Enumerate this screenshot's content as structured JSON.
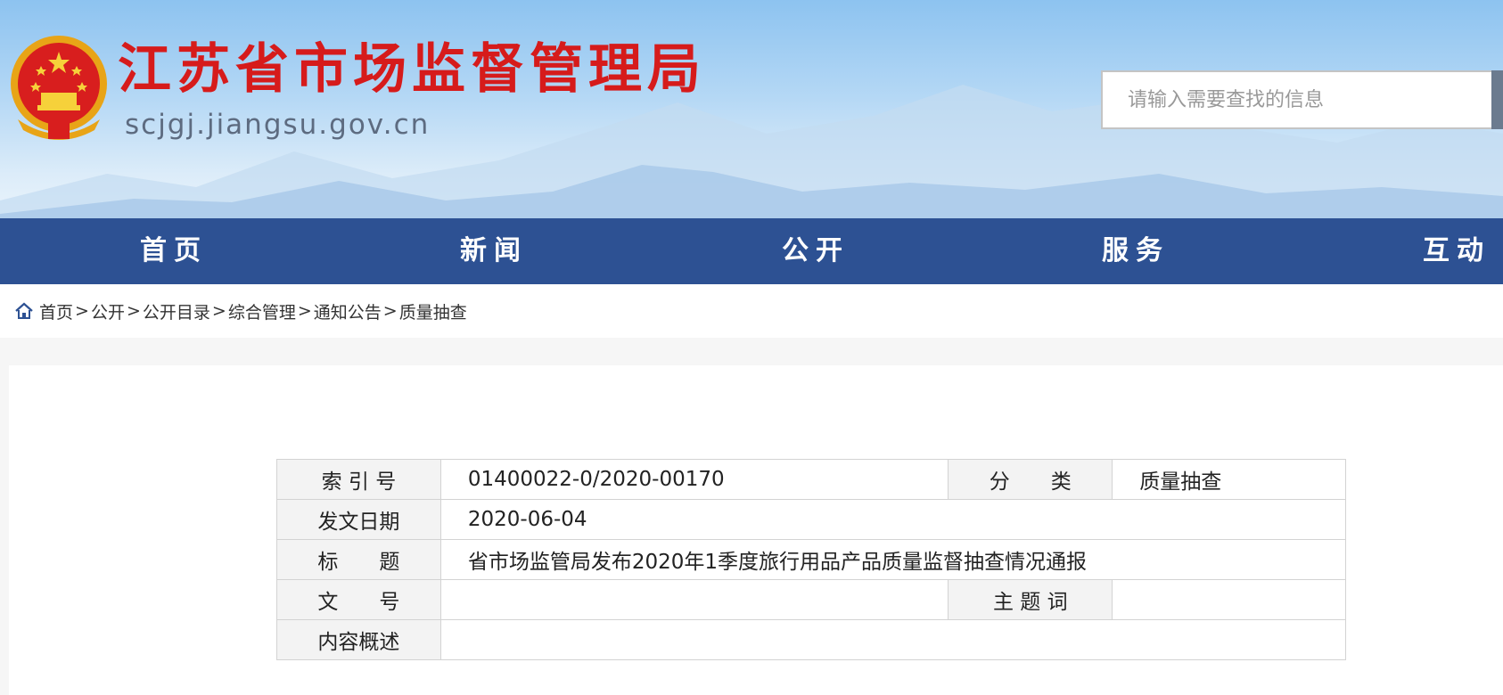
{
  "header": {
    "title": "江苏省市场监督管理局",
    "url": "scjgj.jiangsu.gov.cn",
    "emblem_icon": "national-emblem-icon",
    "brand_color": "#d61b1b",
    "search_placeholder": "请输入需要查找的信息"
  },
  "nav": {
    "color": "#2d5193",
    "items": [
      {
        "label": "首页"
      },
      {
        "label": "新闻"
      },
      {
        "label": "公开"
      },
      {
        "label": "服务"
      },
      {
        "label": "互动"
      }
    ]
  },
  "breadcrumb": {
    "icon": "home-icon",
    "items": [
      "首页",
      "公开",
      "公开目录",
      "综合管理",
      "通知公告",
      "质量抽查"
    ],
    "separator": ">"
  },
  "meta": {
    "index_label": "索 引 号",
    "index_value": "01400022-0/2020-00170",
    "category_label": "分　　类",
    "category_value": "质量抽查",
    "date_label": "发文日期",
    "date_value": "2020-06-04",
    "title_label": "标　　题",
    "title_value": "省市场监管局发布2020年1季度旅行用品产品质量监督抽查情况通报",
    "doc_no_label": "文　　号",
    "doc_no_value": "",
    "keywords_label": "主 题 词",
    "keywords_value": "",
    "summary_label": "内容概述",
    "summary_value": ""
  }
}
